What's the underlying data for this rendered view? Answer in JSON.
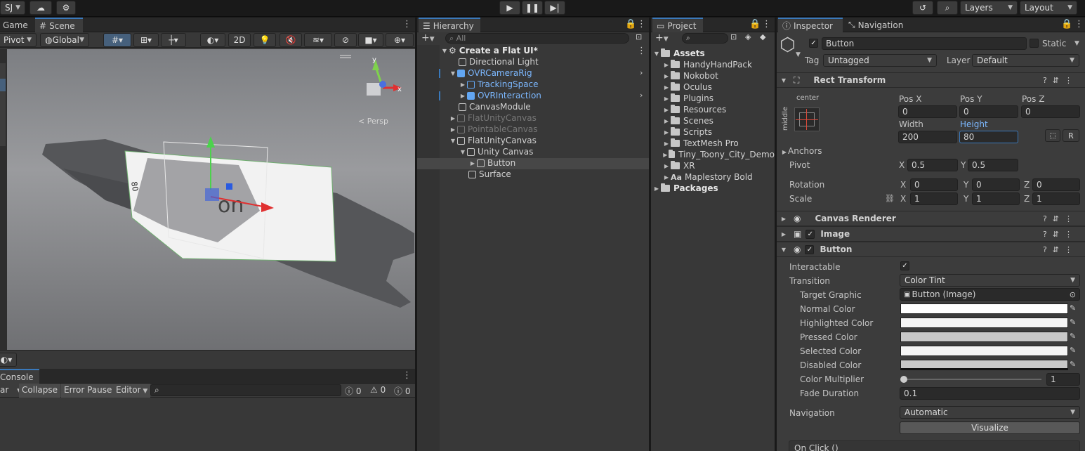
{
  "toolbar": {
    "account": "SJ",
    "layers": "Layers",
    "layout": "Layout"
  },
  "scene": {
    "tabs": [
      "Game",
      "Scene"
    ],
    "pivot": "Pivot",
    "global": "Global",
    "mode2d": "2D",
    "persp": "< Persp",
    "size_label": "80",
    "button_text": "on"
  },
  "console": {
    "tab": "Console",
    "clear": "ar",
    "collapse": "Collapse",
    "error_pause": "Error Pause",
    "editor": "Editor",
    "count_log": "0",
    "count_warn": "0",
    "count_err": "0"
  },
  "hierarchy": {
    "tab": "Hierarchy",
    "search_placeholder": "All",
    "items": [
      {
        "label": "Create a Flat UI*",
        "style": "scene"
      },
      {
        "label": "Directional Light",
        "style": "normal"
      },
      {
        "label": "OVRCameraRig",
        "style": "prefab"
      },
      {
        "label": "TrackingSpace",
        "style": "prefab"
      },
      {
        "label": "OVRInteraction",
        "style": "prefab"
      },
      {
        "label": "CanvasModule",
        "style": "normal"
      },
      {
        "label": "FlatUnityCanvas",
        "style": "disabled"
      },
      {
        "label": "PointableCanvas",
        "style": "disabled"
      },
      {
        "label": "FlatUnityCanvas",
        "style": "normal"
      },
      {
        "label": "Unity Canvas",
        "style": "normal"
      },
      {
        "label": "Button",
        "style": "selected"
      },
      {
        "label": "Surface",
        "style": "normal"
      }
    ]
  },
  "project": {
    "tab": "Project",
    "assets_label": "Assets",
    "folders": [
      "HandyHandPack",
      "Nokobot",
      "Oculus",
      "Plugins",
      "Resources",
      "Scenes",
      "Scripts",
      "TextMesh Pro",
      "Tiny_Toony_City_Demo",
      "XR"
    ],
    "font_asset": "Maplestory Bold",
    "font_prefix": "Aa",
    "packages_label": "Packages"
  },
  "inspector": {
    "tabs": [
      "Inspector",
      "Navigation"
    ],
    "object_name": "Button",
    "static_label": "Static",
    "tag_label": "Tag",
    "tag_value": "Untagged",
    "layer_label": "Layer",
    "layer_value": "Default",
    "rect": {
      "title": "Rect Transform",
      "anchor_h": "center",
      "anchor_v": "middle",
      "pos_x_label": "Pos X",
      "pos_y_label": "Pos Y",
      "pos_z_label": "Pos Z",
      "pos_x": "0",
      "pos_y": "0",
      "pos_z": "0",
      "width_label": "Width",
      "height_label": "Height",
      "width": "200",
      "height": "80",
      "r_btn": "R",
      "anchors_label": "Anchors",
      "pivot_label": "Pivot",
      "pivot_x": "0.5",
      "pivot_y": "0.5",
      "rotation_label": "Rotation",
      "rot_x": "0",
      "rot_y": "0",
      "rot_z": "0",
      "scale_label": "Scale",
      "scale_x": "1",
      "scale_y": "1",
      "scale_z": "1",
      "x": "X",
      "y": "Y",
      "z": "Z"
    },
    "canvas_renderer": "Canvas Renderer",
    "image": "Image",
    "button": {
      "title": "Button",
      "interactable_label": "Interactable",
      "transition_label": "Transition",
      "transition_value": "Color Tint",
      "target_label": "Target Graphic",
      "target_value": "Button (Image)",
      "normal_label": "Normal Color",
      "highlighted_label": "Highlighted Color",
      "pressed_label": "Pressed Color",
      "selected_label": "Selected Color",
      "disabled_label": "Disabled Color",
      "multiplier_label": "Color Multiplier",
      "multiplier_value": "1",
      "multiplier_fraction": 0.0,
      "fade_label": "Fade Duration",
      "fade_value": "0.1",
      "navigation_label": "Navigation",
      "navigation_value": "Automatic",
      "visualize": "Visualize",
      "onclick": "On Click ()"
    }
  },
  "colors": {
    "normal": "#ffffff",
    "highlighted": "#f5f5f5",
    "pressed": "#c8c8c8",
    "selected": "#f5f5f5",
    "disabled": "#c8c8c8",
    "accent": "#3a79bb",
    "prefab": "#7cb8ff"
  }
}
